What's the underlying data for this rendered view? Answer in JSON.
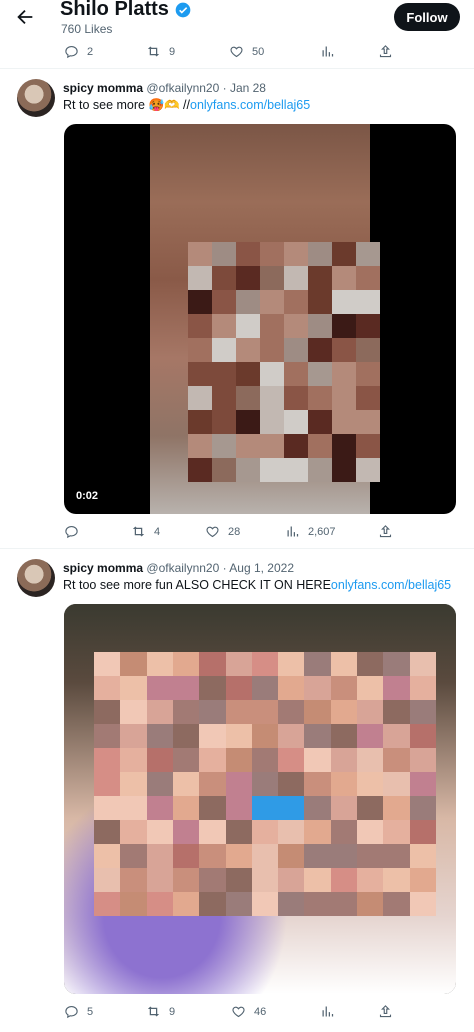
{
  "header": {
    "name": "Shilo Platts",
    "subtitle": "760 Likes",
    "follow_label": "Follow"
  },
  "top_actions": {
    "replies": "2",
    "reposts": "9",
    "likes": "50"
  },
  "tweets": [
    {
      "name": "spicy momma",
      "meta": "@ofkailynn20 · Jan 28",
      "text": "Rt to see more 🥵🫶 //",
      "link": "onlyfans.com/bellaj65",
      "duration": "0:02",
      "replies": "",
      "reposts": "4",
      "likes": "28",
      "views": "2,607"
    },
    {
      "name": "spicy momma",
      "meta": "@ofkailynn20 · Aug 1, 2022",
      "text": "Rt too see more fun ALSO CHECK IT ON HERE",
      "link": "onlyfans.com/bellaj65",
      "replies": "5",
      "reposts": "9",
      "likes": "46"
    }
  ],
  "colors": {
    "accent": "#1d9bf0",
    "text": "#0f1419",
    "muted": "#536471"
  }
}
